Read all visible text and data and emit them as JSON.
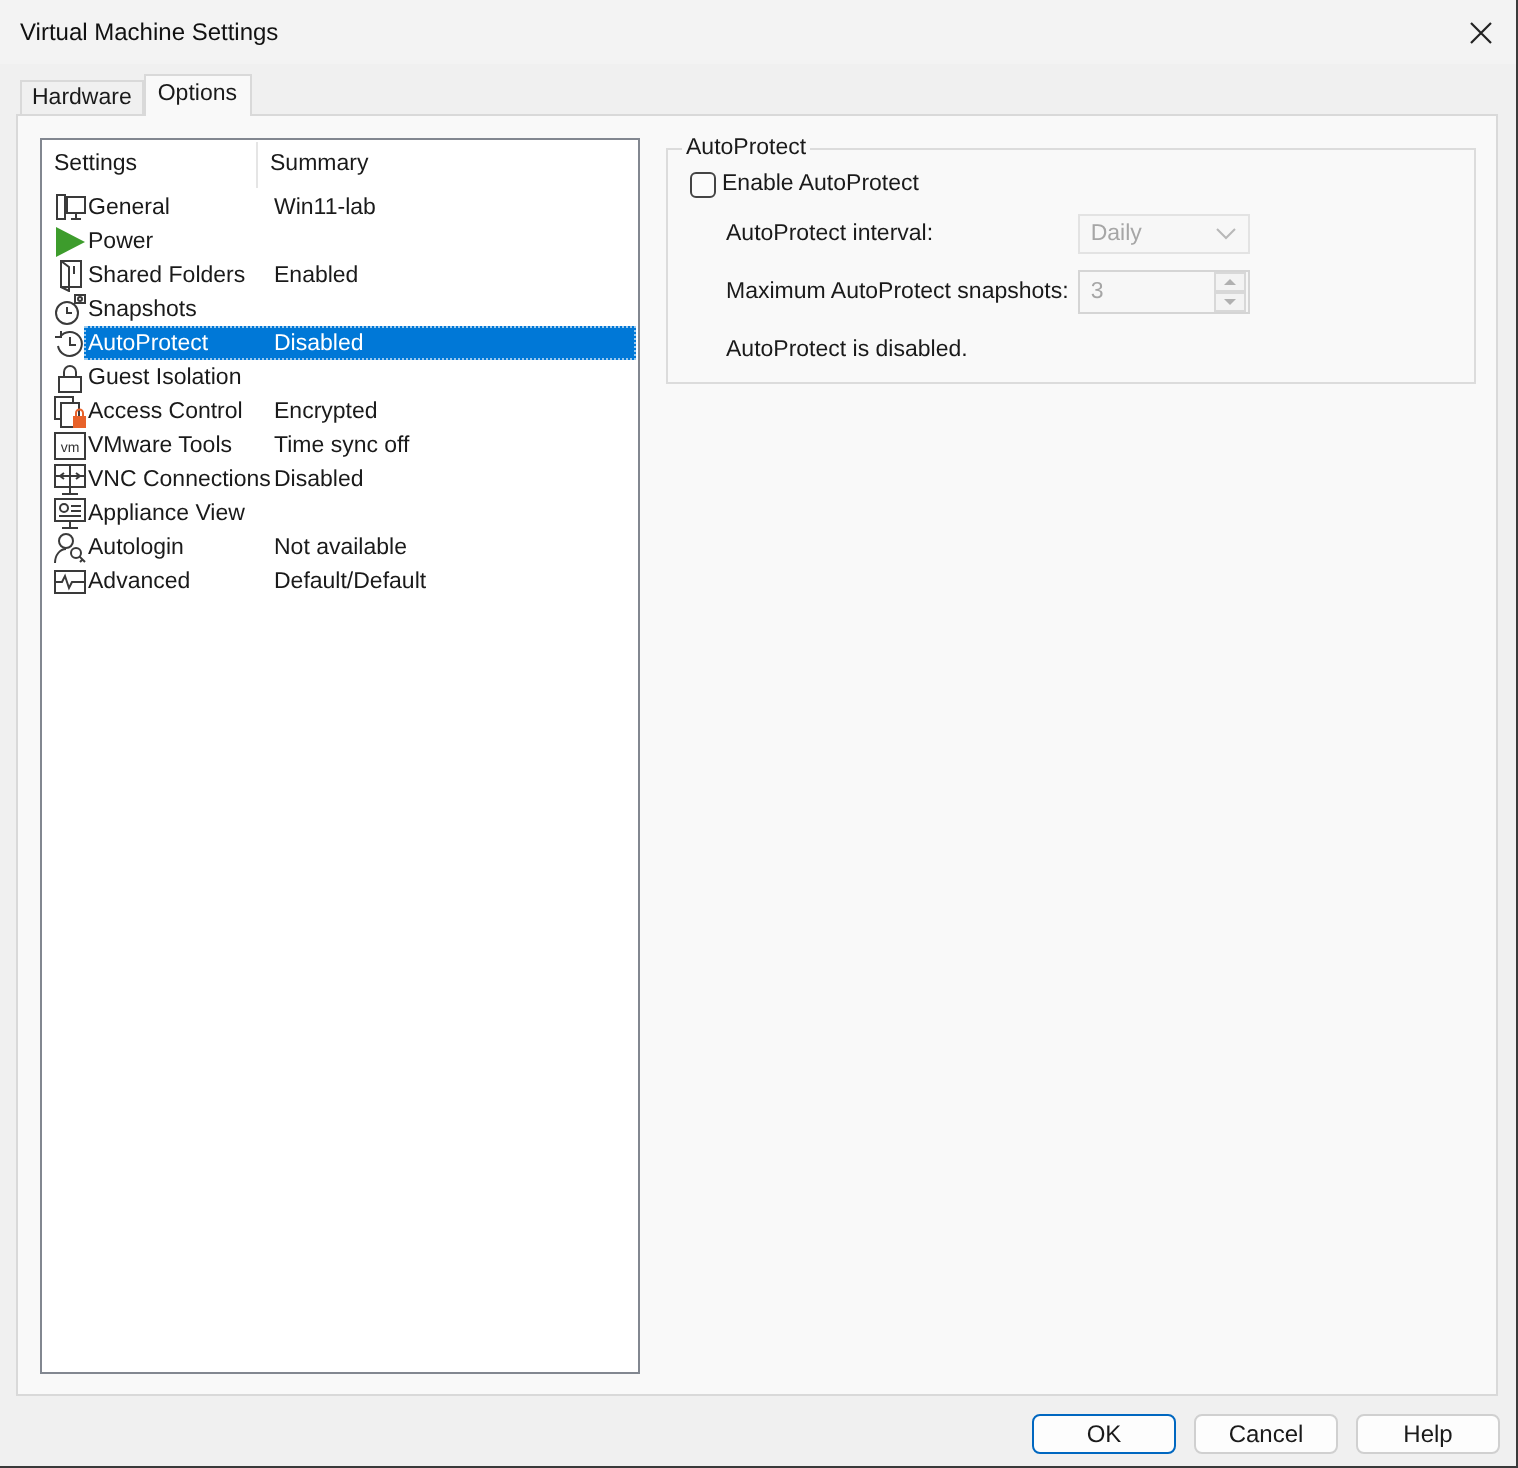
{
  "window": {
    "title": "Virtual Machine Settings"
  },
  "tabs": [
    {
      "label": "Hardware",
      "selected": false
    },
    {
      "label": "Options",
      "selected": true
    }
  ],
  "settings_list": {
    "columns": [
      "Settings",
      "Summary"
    ],
    "items": [
      {
        "name": "General",
        "summary": "Win11-lab",
        "selected": false
      },
      {
        "name": "Power",
        "selected": false
      },
      {
        "name": "Shared Folders",
        "summary": "Enabled",
        "selected": false
      },
      {
        "name": "Snapshots",
        "selected": false
      },
      {
        "name": "AutoProtect",
        "summary": "Disabled",
        "selected": true
      },
      {
        "name": "Guest Isolation",
        "selected": false
      },
      {
        "name": "Access Control",
        "summary": "Encrypted",
        "selected": false
      },
      {
        "name": "VMware Tools",
        "summary": "Time sync off",
        "icon_text": "vm",
        "selected": false
      },
      {
        "name": "VNC Connections",
        "summary": "Disabled",
        "selected": false
      },
      {
        "name": "Appliance View",
        "selected": false
      },
      {
        "name": "Autologin",
        "summary": "Not available",
        "selected": false
      },
      {
        "name": "Advanced",
        "summary": "Default/Default",
        "selected": false
      }
    ]
  },
  "autoprotect": {
    "title": "AutoProtect",
    "enable": {
      "label": "Enable AutoProtect",
      "checked": false
    },
    "interval": {
      "label": "AutoProtect interval:",
      "value": "Daily",
      "disabled": true
    },
    "max_snapshots": {
      "label": "Maximum AutoProtect snapshots:",
      "value": "3",
      "disabled": true
    },
    "status": "AutoProtect is disabled."
  },
  "buttons": [
    {
      "label": "OK",
      "default": true
    },
    {
      "label": "Cancel",
      "default": false
    },
    {
      "label": "Help",
      "default": false
    }
  ]
}
